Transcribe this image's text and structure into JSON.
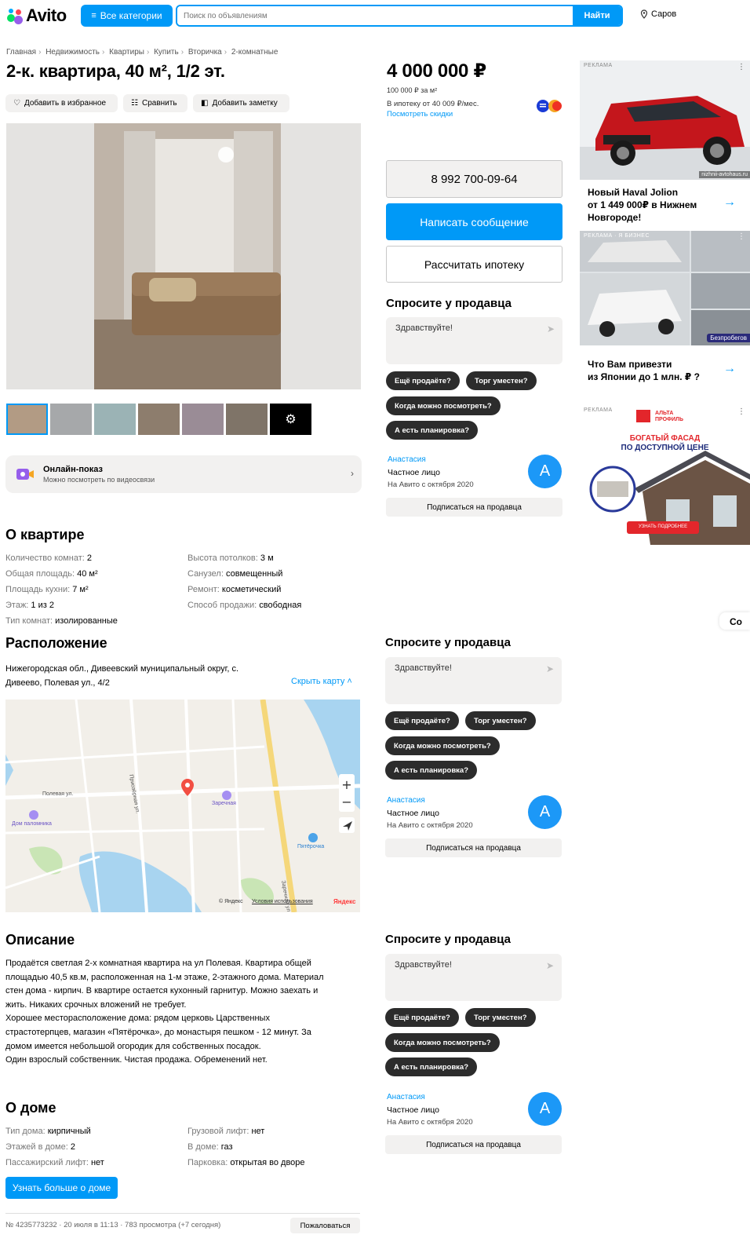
{
  "header": {
    "logo": "Avito",
    "categories_label": "Все категории",
    "search_placeholder": "Поиск по объявлениям",
    "search_button": "Найти",
    "location": "Саров"
  },
  "breadcrumbs": [
    "Главная",
    "Недвижимость",
    "Квартиры",
    "Купить",
    "Вторичка",
    "2-комнатные"
  ],
  "listing": {
    "title": "2-к. квартира, 40 м², 1/2 эт.",
    "actions": {
      "favorite": "Добавить в избранное",
      "compare": "Сравнить",
      "note": "Добавить заметку"
    }
  },
  "online_show": {
    "title": "Онлайн-показ",
    "subtitle": "Можно посмотреть по видеосвязи"
  },
  "about_flat": {
    "heading": "О квартире",
    "left": [
      {
        "k": "Количество комнат",
        "v": "2"
      },
      {
        "k": "Общая площадь",
        "v": "40 м²"
      },
      {
        "k": "Площадь кухни",
        "v": "7 м²"
      },
      {
        "k": "Этаж",
        "v": "1 из 2"
      },
      {
        "k": "Тип комнат",
        "v": "изолированные"
      }
    ],
    "right": [
      {
        "k": "Высота потолков",
        "v": "3 м"
      },
      {
        "k": "Санузел",
        "v": "совмещенный"
      },
      {
        "k": "Ремонт",
        "v": "косметический"
      },
      {
        "k": "Способ продажи",
        "v": "свободная"
      }
    ]
  },
  "location": {
    "heading": "Расположение",
    "address_line1": "Нижегородская обл., Дивеевский муниципальный округ, с.",
    "address_line2": "Дивеево, Полевая ул., 4/2",
    "hide_map": "Скрыть карту",
    "map_labels": {
      "street1": "Полевая ул.",
      "street2": "Приозёрная ул.",
      "street3": "Заречная ул.",
      "zarechnaya": "Заречная",
      "pyaterochka": "Пятёрочка",
      "dom_palomnika": "Дом паломника",
      "copyright": "© Яндекс",
      "terms": "Условия использования",
      "yandex": "Яндекс"
    }
  },
  "description": {
    "heading": "Описание",
    "lines": [
      "Продаётся светлая 2-х комнатная квартира на ул Полевая. Квартира общей",
      "площадью 40,5 кв.м, расположенная на 1-м этаже, 2-этажного дома. Материал",
      "стен дома - кирпич. В квартире остается кухонный гарнитур. Можно заехать и",
      "жить. Никаких срочных вложений не требует.",
      "Хорошее месторасположение дома: рядом церковь Царственных",
      "страстотерпцев, магазин «Пятёрочка», до монастыря пешком - 12 минут. За",
      "домом имеется небольшой огородик для собственных посадок.",
      "Один взрослый собственник. Чистая продажа. Обременений нет."
    ]
  },
  "about_house": {
    "heading": "О доме",
    "left": [
      {
        "k": "Тип дома",
        "v": "кирпичный"
      },
      {
        "k": "Этажей в доме",
        "v": "2"
      },
      {
        "k": "Пассажирский лифт",
        "v": "нет"
      }
    ],
    "right": [
      {
        "k": "Грузовой лифт",
        "v": "нет"
      },
      {
        "k": "В доме",
        "v": "газ"
      },
      {
        "k": "Парковка",
        "v": "открытая во дворе"
      }
    ],
    "more_button": "Узнать больше о доме"
  },
  "footer": {
    "info": "№ 4235773232 · 20 июля в 11:13 · 783 просмотра (+7 сегодня)",
    "report": "Пожаловаться"
  },
  "sidebar": {
    "price": "4 000 000 ₽",
    "price_per_m": "100 000 ₽ за м²",
    "mortgage": "В ипотеку от 40 009 ₽/мес.",
    "discounts": "Посмотреть скидки",
    "phone": "8 992 700-09-64",
    "write_message": "Написать сообщение",
    "calc_mortgage": "Рассчитать ипотеку"
  },
  "ask_seller": {
    "heading": "Спросите у продавца",
    "placeholder": "Здравствуйте!",
    "chips": [
      "Ещё продаёте?",
      "Торг уместен?",
      "Когда можно посмотреть?",
      "А есть планировка?"
    ],
    "seller_name": "Анастасия",
    "seller_type": "Частное лицо",
    "seller_since": "На Авито с октября 2020",
    "avatar_letter": "А",
    "subscribe": "Подписаться на продавца"
  },
  "ads": {
    "label": "РЕКЛАМА",
    "ad1_site": "nizhnii-avtohaus.ru",
    "ad1_text_1": "Новый Haval Jolion",
    "ad1_text_2": "от 1 449 000₽ в Нижнем",
    "ad1_text_3": "Новгороде!",
    "ad2_label": "РЕКЛАМА · Я БИЗНЕС",
    "ad2_badge": "Безпробегов",
    "ad2_text_1": "Что Вам привезти",
    "ad2_text_2": "из Японии до 1 млн. ₽ ?",
    "ad3_brand": "АЛЬТА ПРОФИЛЬ",
    "ad3_line1": "БОГАТЫЙ ФАСАД",
    "ad3_line2": "ПО ДОСТУПНОЙ ЦЕНЕ",
    "ad3_button": "УЗНАТЬ ПОДРОБНЕЕ"
  },
  "side_tab": "Со",
  "colors": {
    "accent": "#0099f7",
    "chip": "#2c2c2c",
    "panel": "#f2f1f0"
  }
}
